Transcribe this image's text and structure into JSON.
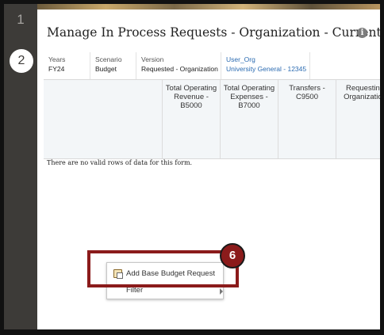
{
  "steps": {
    "step1": "1",
    "step2": "2"
  },
  "form": {
    "title": "Manage In Process Requests - Organization - Current Year"
  },
  "pov": [
    {
      "label": "Years",
      "value": "FY24"
    },
    {
      "label": "Scenario",
      "value": "Budget"
    },
    {
      "label": "Version",
      "value": "Requested - Organization"
    },
    {
      "label": "User_Org",
      "value": "University General - 12345"
    }
  ],
  "columns": [
    "Total Operating Revenue - B5000",
    "Total Operating Expenses - B7000",
    "Transfers - C9500",
    "Requesting Organization"
  ],
  "message": "There are no valid rows of data for this form.",
  "context_menu": {
    "items": [
      {
        "label": "Add Base Budget Request",
        "icon": "add-request-icon"
      },
      {
        "label": "Filter",
        "submenu": true
      }
    ]
  },
  "callout": {
    "number": "6"
  },
  "colors": {
    "callout": "#8b1b1b",
    "link": "#2b6bb1",
    "rail": "#3d3b38"
  }
}
